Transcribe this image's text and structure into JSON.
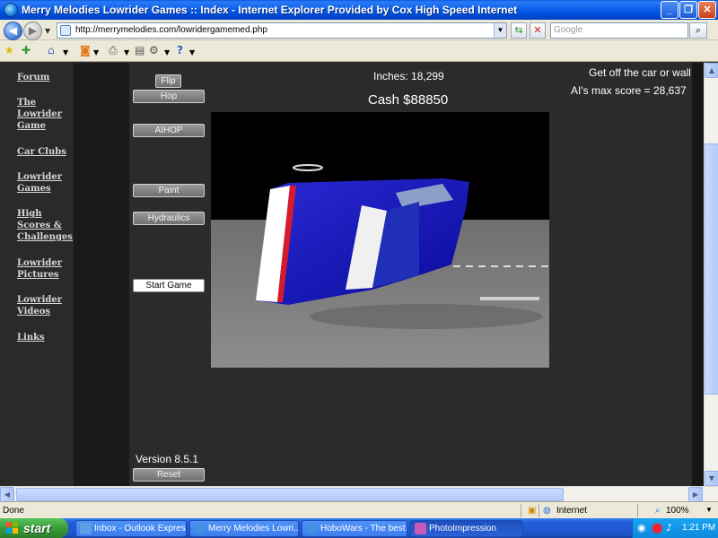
{
  "window": {
    "title": "Merry Melodies Lowrider Games :: Index - Internet Explorer Provided by Cox High Speed Internet",
    "minimize": "_",
    "restore": "❐",
    "close": "✕"
  },
  "address_bar": {
    "url": "http://merrymelodies.com/lowridergamemed.php",
    "search_placeholder": "Google"
  },
  "sidebar": {
    "items": [
      {
        "label": "Forum"
      },
      {
        "label": "The Lowrider Game"
      },
      {
        "label": "Car Clubs"
      },
      {
        "label": "Lowrider Games"
      },
      {
        "label": "High Scores & Challenges"
      },
      {
        "label": "Lowrider Pictures"
      },
      {
        "label": "Lowrider Videos"
      },
      {
        "label": "Links"
      }
    ]
  },
  "game": {
    "buttons": {
      "flip": "Flip",
      "hop": "Hop",
      "aihop": "AIHOP",
      "paint": "Paint",
      "hydraulics": "Hydraulics",
      "start": "Start Game",
      "reset": "Reset"
    },
    "inches": "Inches: 18,299",
    "cash": "Cash $88850",
    "message": "Get off the car or wall",
    "ai_max_score": "AI's max score = 28,637",
    "version": "Version 8.5.1"
  },
  "statusbar": {
    "status": "Done",
    "zone": "Internet",
    "zoom": "100%"
  },
  "taskbar": {
    "start_label": "start",
    "tasks": [
      {
        "label": "Inbox - Outlook Express"
      },
      {
        "label": "Merry Melodies Lowri..."
      },
      {
        "label": "HoboWars - The best..."
      },
      {
        "label": "PhotoImpression"
      }
    ],
    "clock": "1:21 PM"
  }
}
